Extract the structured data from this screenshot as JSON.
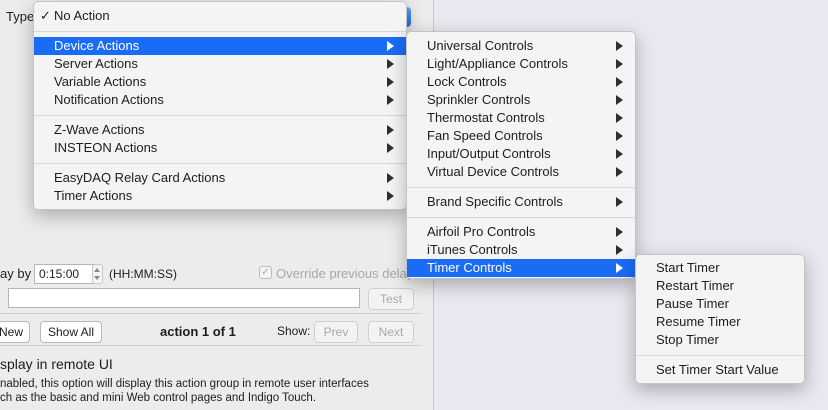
{
  "panel": {
    "type_label": "Type",
    "delay_label": "ay by",
    "delay_value": "0:15:00",
    "delay_format": "(HH:MM:SS)",
    "override_label": "Override previous delay",
    "test_button": "Test",
    "new_button": "New",
    "show_all_button": "Show All",
    "action_counter": "action 1 of 1",
    "show_label": "Show:",
    "prev_button": "Prev",
    "next_button": "Next",
    "remote_ui_heading": "splay in remote UI",
    "remote_ui_desc_line1": "nabled, this option will display this action group in remote user interfaces",
    "remote_ui_desc_line2": "ch as the basic and mini Web control pages and Indigo Touch."
  },
  "type_menu": {
    "checkmark": "✓",
    "no_action": "No Action",
    "items": [
      {
        "label": "Device Actions"
      },
      {
        "label": "Server Actions"
      },
      {
        "label": "Variable Actions"
      },
      {
        "label": "Notification Actions"
      },
      {
        "label": "Z-Wave Actions"
      },
      {
        "label": "INSTEON Actions"
      },
      {
        "label": "EasyDAQ Relay Card Actions"
      },
      {
        "label": "Timer Actions"
      }
    ]
  },
  "device_menu": {
    "items": [
      {
        "label": "Universal Controls"
      },
      {
        "label": "Light/Appliance Controls"
      },
      {
        "label": "Lock Controls"
      },
      {
        "label": "Sprinkler Controls"
      },
      {
        "label": "Thermostat Controls"
      },
      {
        "label": "Fan Speed Controls"
      },
      {
        "label": "Input/Output Controls"
      },
      {
        "label": "Virtual Device Controls"
      },
      {
        "label": "Brand Specific Controls"
      },
      {
        "label": "Airfoil Pro Controls"
      },
      {
        "label": "iTunes Controls"
      },
      {
        "label": "Timer Controls"
      }
    ]
  },
  "timer_menu": {
    "items": [
      {
        "label": "Start Timer"
      },
      {
        "label": "Restart Timer"
      },
      {
        "label": "Pause Timer"
      },
      {
        "label": "Resume Timer"
      },
      {
        "label": "Stop Timer"
      },
      {
        "label": "Set Timer Start Value"
      }
    ]
  },
  "colors": {
    "selection": "#1a6cf4",
    "desktop": "#e9e8f0",
    "panel": "#ececec"
  }
}
